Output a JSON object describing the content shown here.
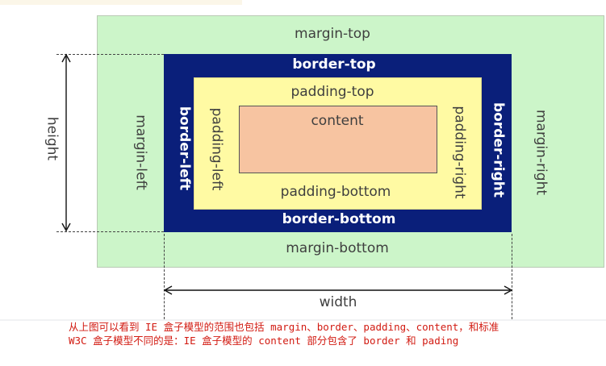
{
  "diagram": {
    "margin": {
      "top": "margin-top",
      "bottom": "margin-bottom",
      "left": "margin-left",
      "right": "margin-right"
    },
    "border": {
      "top": "border-top",
      "bottom": "border-bottom",
      "left": "border-left",
      "right": "border-right"
    },
    "padding": {
      "top": "padding-top",
      "bottom": "padding-bottom",
      "left": "padding-left",
      "right": "padding-right"
    },
    "content": "content",
    "dimensions": {
      "height": "height",
      "width": "width"
    },
    "colors": {
      "margin": "#ccf5c9",
      "border": "#0a1f7a",
      "padding": "#fffaa3",
      "content": "#f7c4a1",
      "note_text": "#d21b12"
    }
  },
  "note": {
    "line1": "从上图可以看到 IE 盒子模型的范围也包括 margin、border、padding、content，和标准",
    "line2": "W3C 盒子模型不同的是：IE 盒子模型的 content 部分包含了 border 和 pading"
  }
}
